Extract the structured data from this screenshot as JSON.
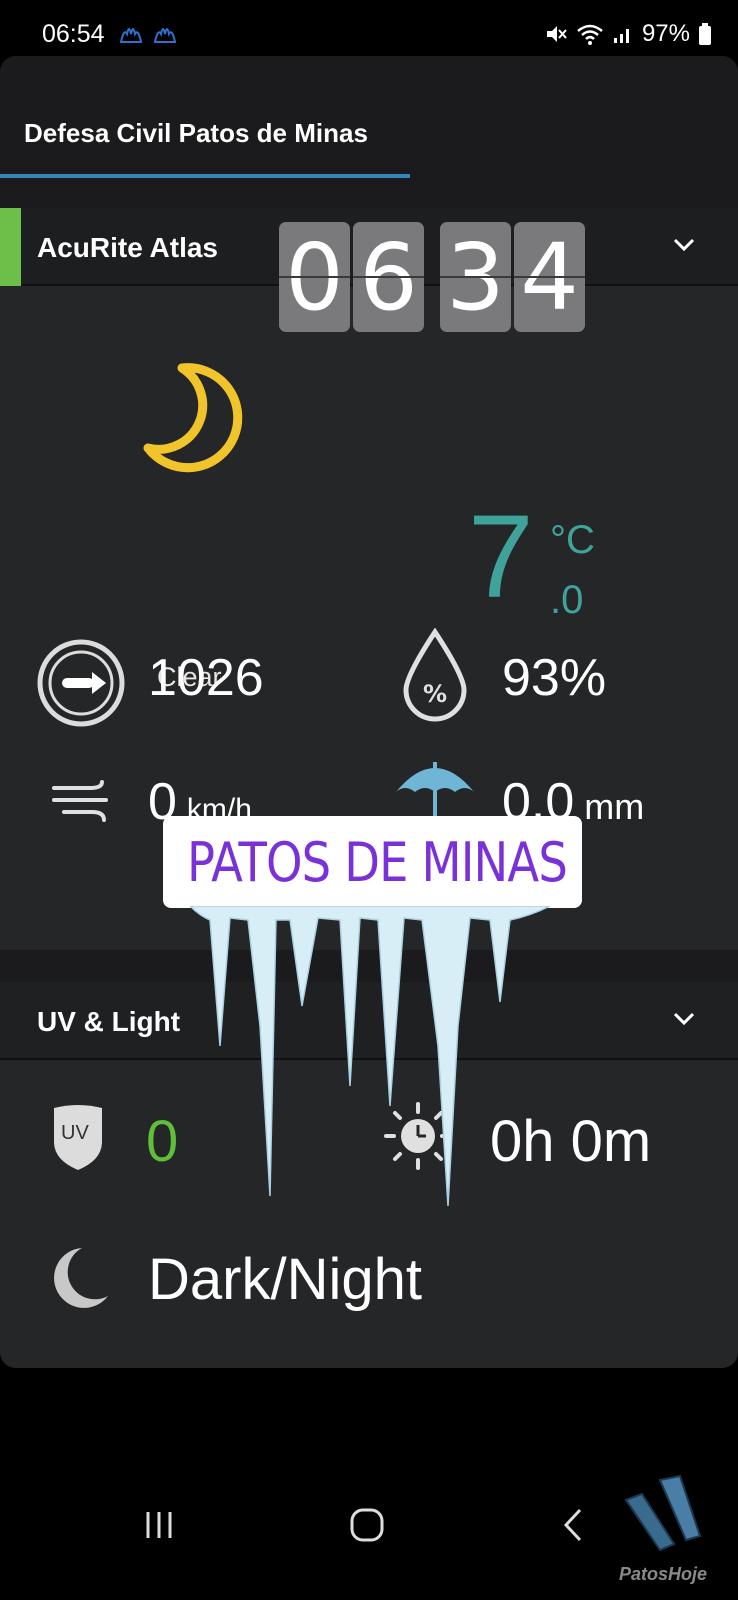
{
  "status_bar": {
    "time": "06:54",
    "battery": "97%",
    "icons": [
      "notification-icon",
      "notification-icon",
      "mute-icon",
      "wifi-icon",
      "signal-icon",
      "battery-icon"
    ]
  },
  "tabs": [
    {
      "label": "Defesa Civil Patos de Minas",
      "selected": true
    }
  ],
  "station_card": {
    "title": "AcuRite Atlas",
    "accent_color": "#6cc04a",
    "clock_digits": [
      "0",
      "6",
      "3",
      "4"
    ],
    "condition_icon": "moon-icon",
    "condition": "Clear",
    "temperature": "7",
    "temperature_unit": "°C",
    "temperature_decimal": ".0",
    "pressure": "1026",
    "humidity": "93%",
    "wind_speed": "0",
    "wind_unit": "km/h",
    "rain": "0.0",
    "rain_unit": "mm"
  },
  "location_sticker": {
    "text": "PATOS DE MINAS",
    "color": "#7a32d8"
  },
  "uv_card": {
    "title": "UV & Light",
    "uv_badge": "UV",
    "uv_value": "0",
    "uv_color": "#5fbf3a",
    "sun_duration": "0h 0m",
    "light_state": "Dark/Night"
  },
  "watermark": {
    "text": "PatosHoje"
  }
}
